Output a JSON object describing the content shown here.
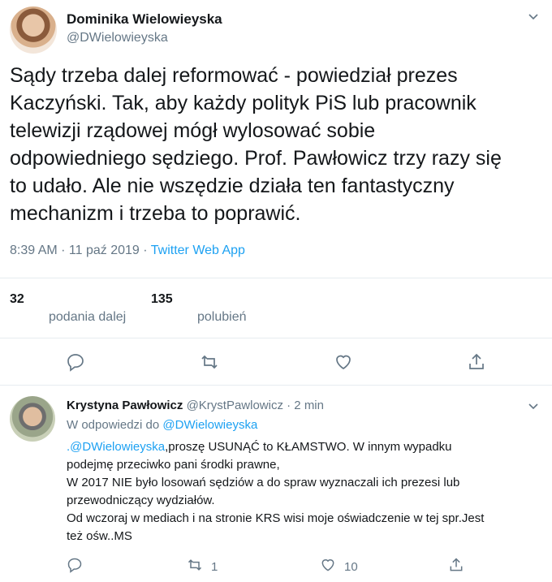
{
  "tweet": {
    "author_name": "Dominika Wielowieyska",
    "author_handle": "@DWielowieyska",
    "text": "Sądy trzeba dalej reformować - powiedział prezes\nKaczyński. Tak, aby każdy polityk PiS lub pracownik\ntelewizji rządowej mógł wylosować sobie\nodpowiedniego sędziego. Prof. Pawłowicz trzy razy się\nto udało. Ale nie wszędzie działa ten fantastyczny\nmechanizm i trzeba to poprawić.",
    "time": "8:39 AM · 11 paź 2019 · ",
    "source": "Twitter Web App",
    "retweets_count": "32",
    "retweets_label": "podania dalej",
    "likes_count": "135",
    "likes_label": "polubień"
  },
  "reply": {
    "author_name": "Krystyna Pawłowicz",
    "author_handle": "@KrystPawlowicz · 2 min",
    "replying_prefix": "W odpowiedzi do ",
    "replying_mention": "@DWielowieyska",
    "mention": ".@DWielowieyska",
    "text_rest": ",proszę USUNĄĆ to KŁAMSTWO. W innym wypadku\npodejmę przeciwko pani środki prawne,\nW 2017 NIE było losowań sędziów a do spraw wyznaczali ich prezesi lub\nprzewodniczący wydziałów.\nOd wczoraj w mediach i na stronie KRS wisi moje oświadczenie w tej spr.Jest\nteż ośw..MS",
    "retweet_count": "1",
    "like_count": "10"
  },
  "icons": [
    "chevron-down-icon",
    "reply-icon",
    "retweet-icon",
    "like-icon",
    "share-icon"
  ]
}
